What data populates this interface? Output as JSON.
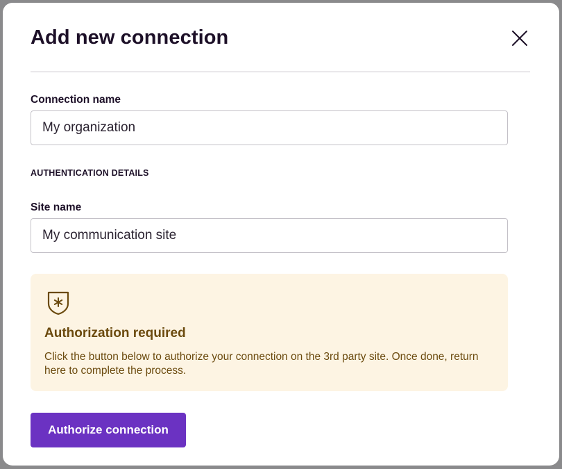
{
  "modal": {
    "title": "Add new connection",
    "close_icon": "close-icon"
  },
  "form": {
    "connection_name": {
      "label": "Connection name",
      "value": "My organization"
    },
    "auth_section_heading": "AUTHENTICATION DETAILS",
    "site_name": {
      "label": "Site name",
      "value": "My communication site"
    }
  },
  "notice": {
    "icon": "shield-asterisk-icon",
    "title": "Authorization required",
    "body": "Click the button below to authorize your connection on the 3rd party site. Once done, return here to complete the process.",
    "background": "#fdf4e3",
    "text_color": "#6b4a0e"
  },
  "actions": {
    "authorize_label": "Authorize connection",
    "accent": "#6b32c2"
  }
}
